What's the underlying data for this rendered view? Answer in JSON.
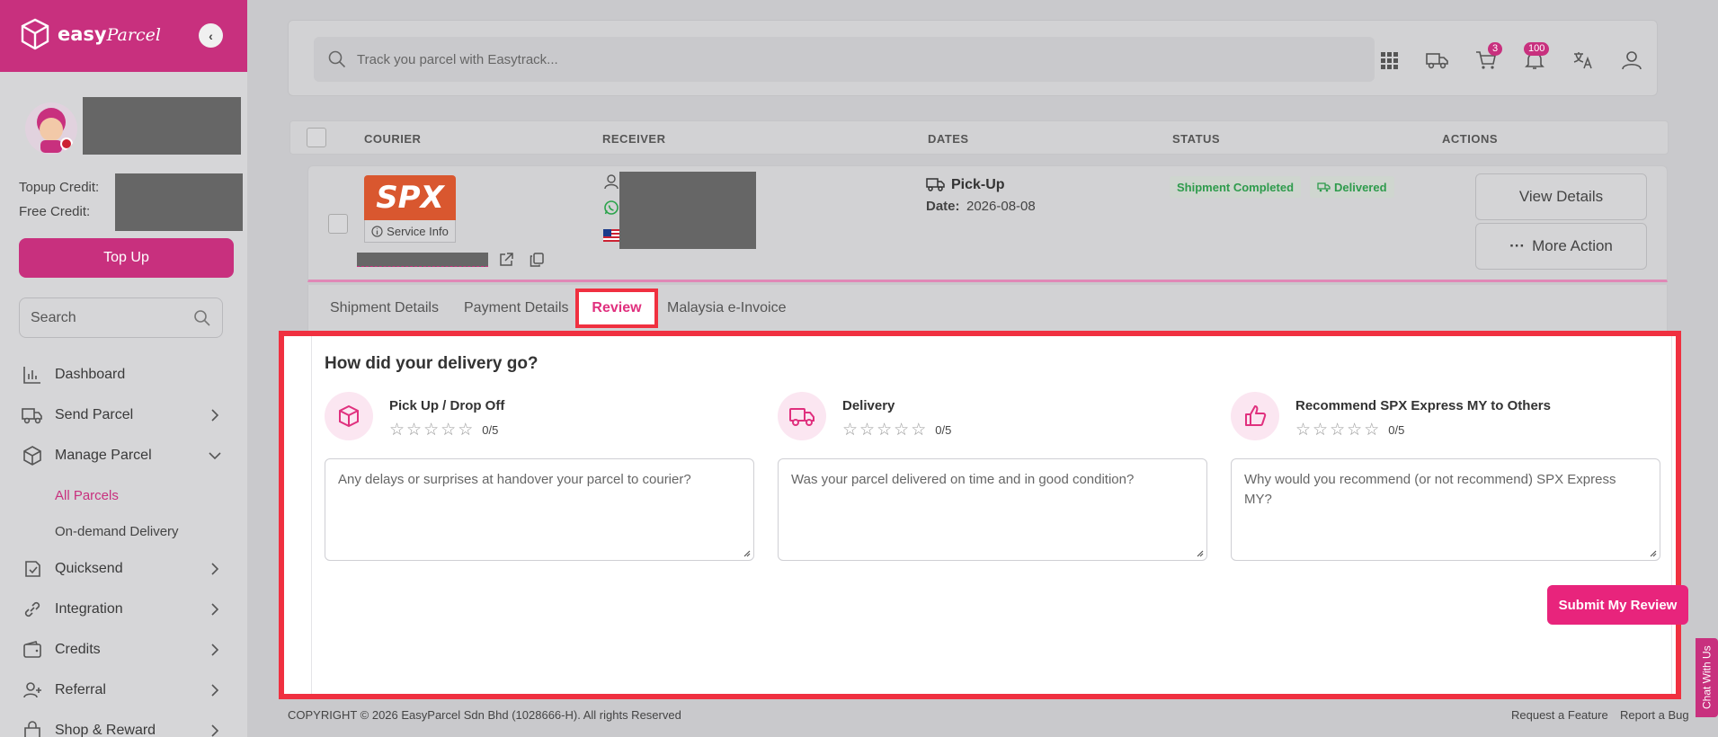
{
  "brand": {
    "name_bold": "easy",
    "name_script": "Parcel",
    "accent": "#c8307e"
  },
  "sidebar": {
    "topup_credit_label": "Topup Credit:",
    "free_credit_label": "Free Credit:",
    "topup_button": "Top Up",
    "search_placeholder": "Search",
    "nav": [
      {
        "label": "Dashboard",
        "icon": "chart-icon"
      },
      {
        "label": "Send Parcel",
        "icon": "truck-icon"
      },
      {
        "label": "Manage Parcel",
        "icon": "box-icon"
      },
      {
        "label": "Quicksend",
        "icon": "quicksend-icon"
      },
      {
        "label": "Integration",
        "icon": "link-icon"
      },
      {
        "label": "Credits",
        "icon": "wallet-icon"
      },
      {
        "label": "Referral",
        "icon": "user-plus-icon"
      },
      {
        "label": "Shop & Reward",
        "icon": "shop-icon"
      }
    ],
    "sub_items": {
      "all_parcels": "All Parcels",
      "on_demand": "On-demand Delivery"
    }
  },
  "topbar": {
    "search_placeholder": "Track you parcel with Easytrack...",
    "cart_count": "3",
    "notif_count": "100"
  },
  "table": {
    "headers": {
      "courier": "COURIER",
      "receiver": "RECEIVER",
      "dates": "DATES",
      "status": "STATUS",
      "actions": "ACTIONS"
    },
    "row": {
      "courier_logo": "SPX",
      "service_info": "Service Info",
      "pickup_label": "Pick-Up",
      "date_label": "Date:",
      "date_value": "2026-08-08",
      "status_completed": "Shipment Completed",
      "status_delivered": "Delivered",
      "view_details": "View Details",
      "more_action": "More Action"
    }
  },
  "tabs": {
    "shipment": "Shipment Details",
    "payment": "Payment Details",
    "review": "Review",
    "einvoice": "Malaysia e-Invoice"
  },
  "review": {
    "title": "How did your delivery go?",
    "columns": [
      {
        "label": "Pick Up / Drop Off",
        "score": "0/5",
        "placeholder": "Any delays or surprises at handover your parcel to courier?"
      },
      {
        "label": "Delivery",
        "score": "0/5",
        "placeholder": "Was your parcel delivered on time and in good condition?"
      },
      {
        "label": "Recommend SPX Express MY to Others",
        "score": "0/5",
        "placeholder": "Why would you recommend (or not recommend) SPX Express MY?"
      }
    ],
    "submit": "Submit My Review"
  },
  "footer": {
    "copyright": "COPYRIGHT © 2026 EasyParcel Sdn Bhd (1028666-H). All rights Reserved",
    "request_feature": "Request a Feature",
    "report_bug": "Report a Bug",
    "chat": "Chat With Us"
  }
}
